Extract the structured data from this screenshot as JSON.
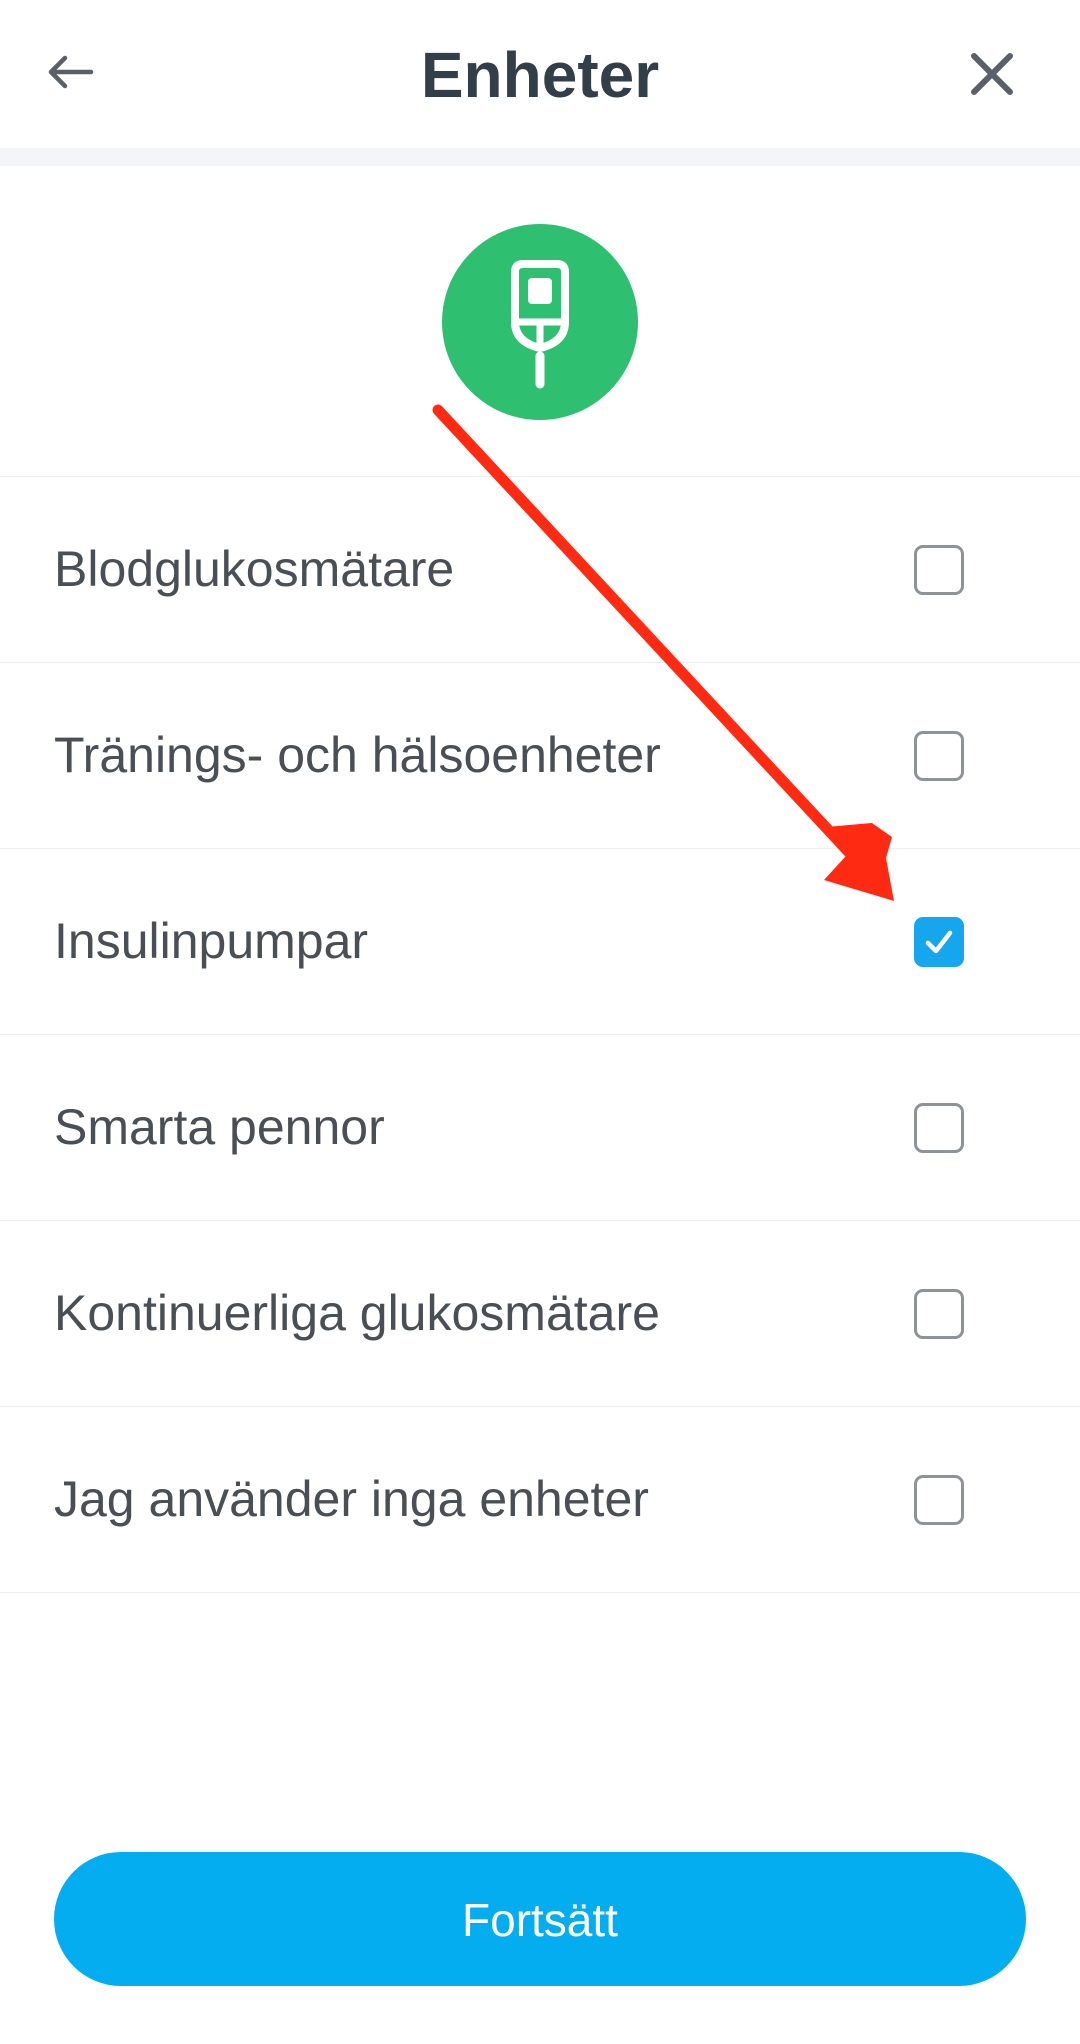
{
  "header": {
    "title": "Enheter",
    "back_icon": "arrow-left-icon",
    "close_icon": "close-icon"
  },
  "hero": {
    "icon": "glucose-meter-icon",
    "color": "#2fbf71"
  },
  "devices": {
    "items": [
      {
        "label": "Blodglukosmätare",
        "checked": false
      },
      {
        "label": "Tränings- och hälsoenheter",
        "checked": false
      },
      {
        "label": "Insulinpumpar",
        "checked": true
      },
      {
        "label": "Smarta pennor",
        "checked": false
      },
      {
        "label": "Kontinuerliga glukosmätare",
        "checked": false
      },
      {
        "label": "Jag använder inga enheter",
        "checked": false
      }
    ]
  },
  "annotation": {
    "icon": "red-arrow-annotation",
    "color": "#ff2a12"
  },
  "footer": {
    "continue_label": "Fortsätt",
    "color": "#04adef"
  }
}
